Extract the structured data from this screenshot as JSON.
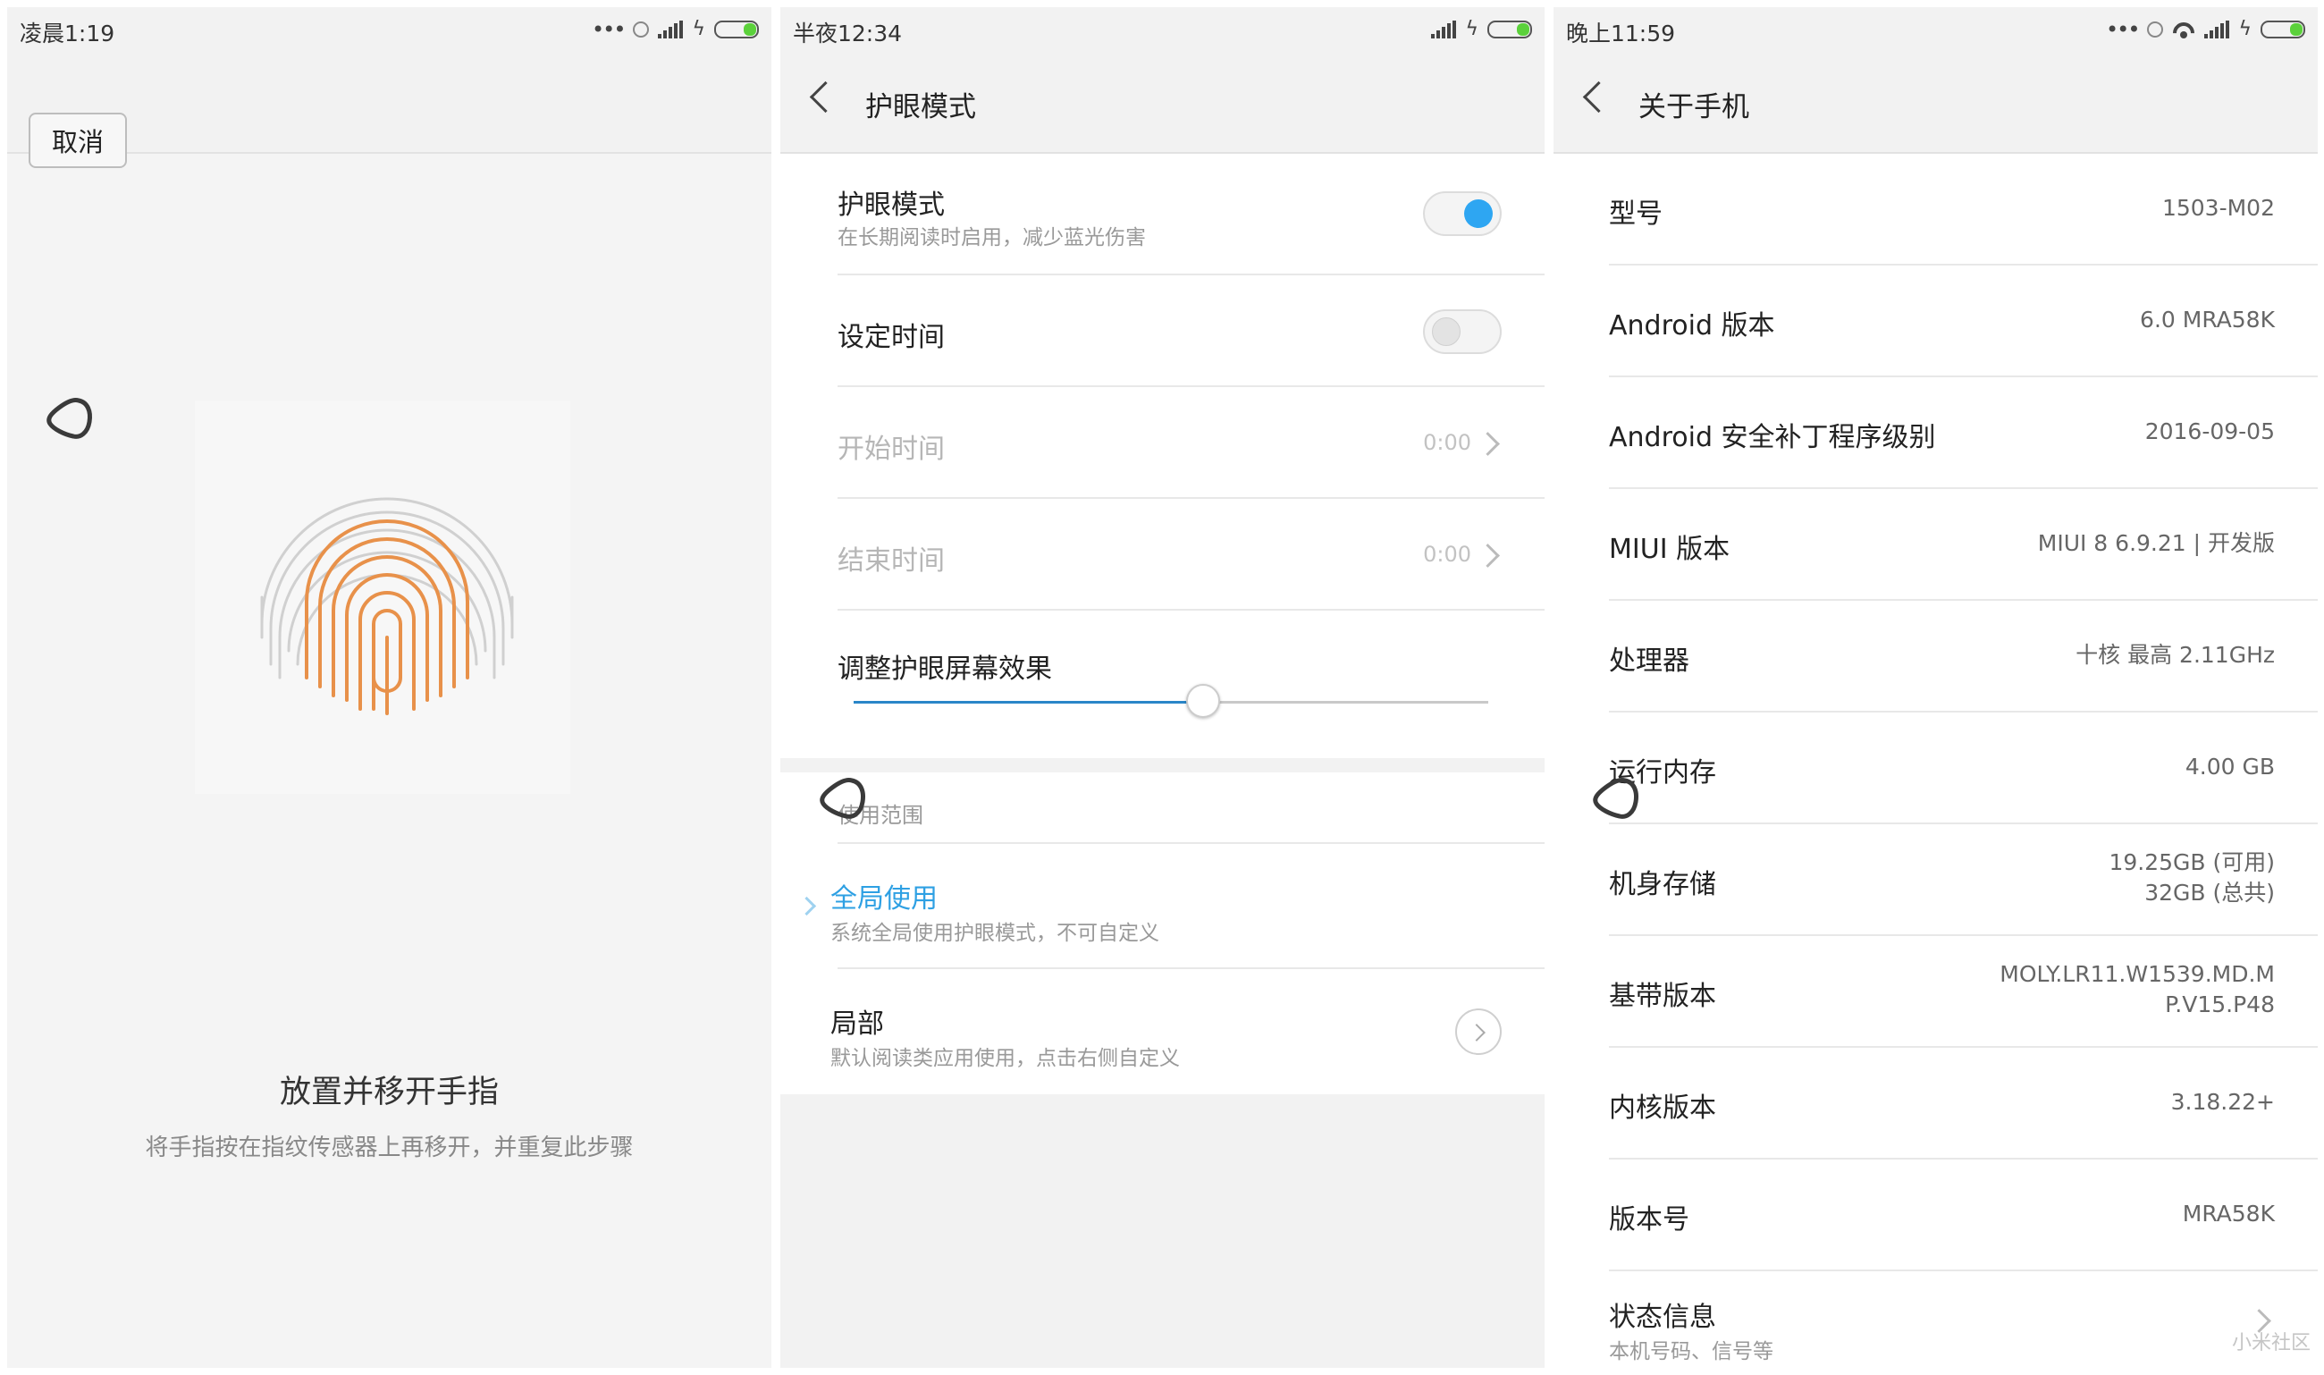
{
  "colors": {
    "accent": "#2ea6f2",
    "link_blue": "#2ea0e3",
    "fingerprint_active": "#e8914a",
    "fingerprint_inactive": "#cfcfcf",
    "battery_green": "#5bd13b"
  },
  "panel1": {
    "status_time": "凌晨1:19",
    "cancel_label": "取消",
    "title": "放置并移开手指",
    "subtitle": "将手指按在指纹传感器上再移开，并重复此步骤"
  },
  "panel2": {
    "status_time": "半夜12:34",
    "header_title": "护眼模式",
    "eye_mode": {
      "title": "护眼模式",
      "subtitle": "在长期阅读时启用，减少蓝光伤害",
      "enabled": true
    },
    "schedule": {
      "title": "设定时间",
      "enabled": false
    },
    "start_time": {
      "title": "开始时间",
      "value": "0:00"
    },
    "end_time": {
      "title": "结束时间",
      "value": "0:00"
    },
    "effect": {
      "title": "调整护眼屏幕效果",
      "level": 0.55
    },
    "scope_label": "使用范围",
    "global": {
      "title": "全局使用",
      "subtitle": "系统全局使用护眼模式，不可自定义"
    },
    "partial": {
      "title": "局部",
      "subtitle": "默认阅读类应用使用，点击右侧自定义"
    }
  },
  "panel3": {
    "status_time": "晚上11:59",
    "header_title": "关于手机",
    "items": [
      {
        "label": "型号",
        "value": "1503-M02"
      },
      {
        "label": "Android 版本",
        "value": "6.0 MRA58K"
      },
      {
        "label": "Android 安全补丁程序级别",
        "value": "2016-09-05"
      },
      {
        "label": "MIUI 版本",
        "value": "MIUI 8 6.9.21 | 开发版"
      },
      {
        "label": "处理器",
        "value": "十核 最高 2.11GHz"
      },
      {
        "label": "运行内存",
        "value": "4.00 GB"
      },
      {
        "label": "机身存储",
        "value_line1": "19.25GB (可用)",
        "value_line2": "32GB (总共)"
      },
      {
        "label": "基带版本",
        "value_line1": "MOLY.LR11.W1539.MD.M",
        "value_line2": "P.V15.P48"
      },
      {
        "label": "内核版本",
        "value": "3.18.22+"
      },
      {
        "label": "版本号",
        "value": "MRA58K"
      },
      {
        "label": "状态信息",
        "sub": "本机号码、信号等"
      }
    ],
    "watermark": "小米社区"
  },
  "icons": {
    "status": [
      "more-dots-icon",
      "sync-icon",
      "wifi-icon",
      "signal-icon",
      "charging-icon",
      "battery-icon"
    ],
    "navigation": [
      "back-arrow-icon",
      "chevron-right-icon",
      "circle-arrow-icon",
      "assistive-touch-icon",
      "fingerprint-icon"
    ]
  }
}
